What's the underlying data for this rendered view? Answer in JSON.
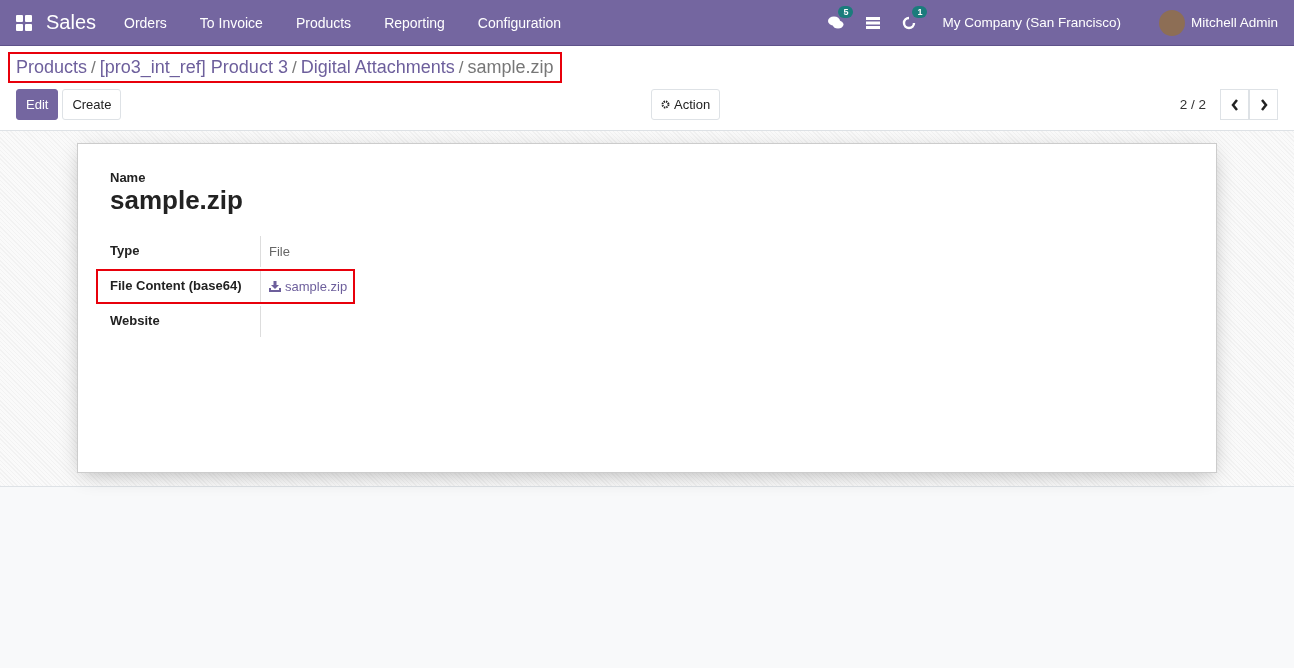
{
  "navbar": {
    "app": "Sales",
    "menu": [
      "Orders",
      "To Invoice",
      "Products",
      "Reporting",
      "Configuration"
    ],
    "messages_badge": "5",
    "activities_badge": "1",
    "company": "My Company (San Francisco)",
    "user": "Mitchell Admin"
  },
  "breadcrumb": {
    "highlighted": true,
    "separator": "/",
    "items": [
      "Products",
      "[pro3_int_ref] Product 3",
      "Digital Attachments",
      "sample.zip"
    ]
  },
  "buttons": {
    "edit": "Edit",
    "create": "Create",
    "action": "Action"
  },
  "pager": "2 / 2",
  "form": {
    "name_label": "Name",
    "name": "sample.zip",
    "fields": [
      {
        "label": "Type",
        "value": "File",
        "kind": "text",
        "highlighted": false
      },
      {
        "label": "File Content (base64)",
        "value": "sample.zip",
        "kind": "download",
        "highlighted": true
      },
      {
        "label": "Website",
        "kind": "empty",
        "highlighted": false
      }
    ]
  }
}
